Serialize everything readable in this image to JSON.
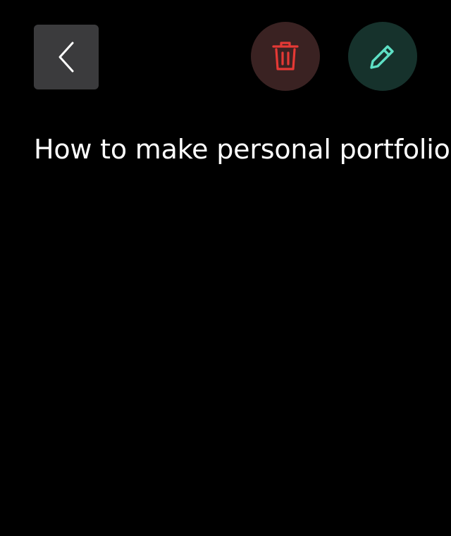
{
  "colors": {
    "background": "#000000",
    "back_button_bg": "#3b3b3d",
    "delete_button_bg": "#3a2222",
    "delete_icon": "#e53935",
    "edit_button_bg": "#16322c",
    "edit_icon": "#5ee0c5",
    "title_text": "#ffffff"
  },
  "header": {
    "back_icon": "chevron-left-icon",
    "delete_icon": "trash-icon",
    "edit_icon": "pencil-icon"
  },
  "note": {
    "title": "How to make personal portfolio"
  }
}
